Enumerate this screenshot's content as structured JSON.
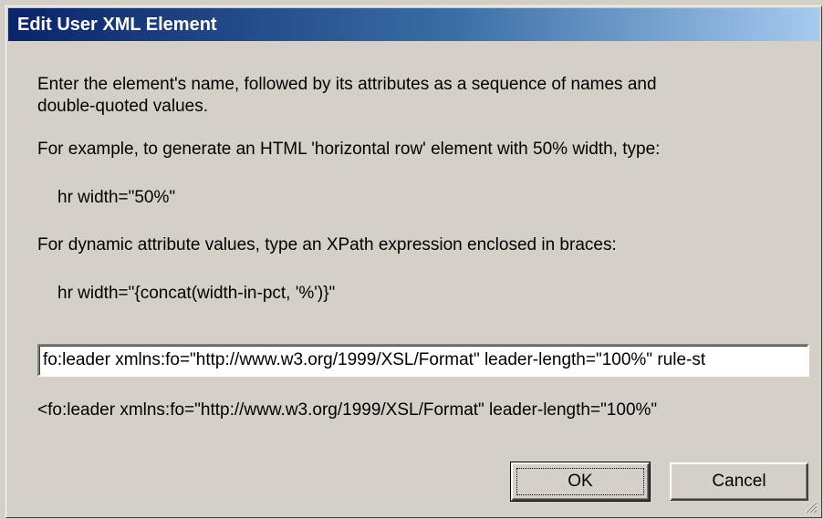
{
  "window": {
    "title": "Edit User XML Element"
  },
  "instructions": {
    "line1": "Enter the element's name, followed by its attributes as a sequence of names and",
    "line2": "double-quoted values.",
    "example_intro": "For example, to generate an HTML 'horizontal row' element with 50% width, type:",
    "example_code": "hr width=\"50%\"",
    "dynamic_intro": "For dynamic attribute values, type an XPath expression enclosed in braces:",
    "dynamic_code": "hr width=\"{concat(width-in-pct, '%')}\""
  },
  "input": {
    "value": "fo:leader xmlns:fo=\"http://www.w3.org/1999/XSL/Format\" leader-length=\"100%\" rule-st"
  },
  "preview": {
    "text": "<fo:leader xmlns:fo=\"http://www.w3.org/1999/XSL/Format\" leader-length=\"100%\""
  },
  "buttons": {
    "ok_label": "OK",
    "cancel_label": "Cancel"
  },
  "icons": {
    "resize_grip": "resize-grip-icon"
  }
}
